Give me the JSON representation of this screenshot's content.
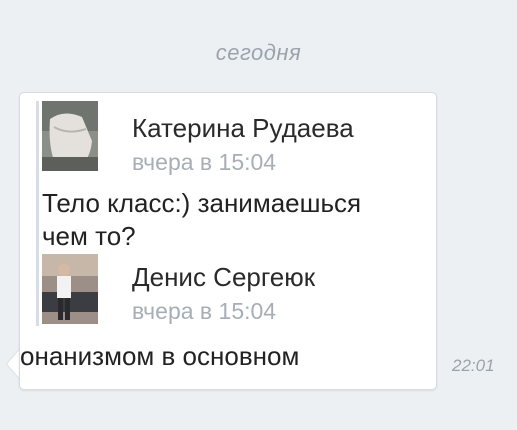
{
  "date_separator": "сегодня",
  "message": {
    "forwarded": [
      {
        "author": "Катерина Рудаева",
        "time": "вчера в 15:04",
        "text": "Тело класс:) занимаешься чем то?"
      },
      {
        "author": "Денис Сергеюк",
        "time": "вчера в 15:04"
      }
    ],
    "text": "онанизмом в основном",
    "sent_time": "22:01"
  }
}
